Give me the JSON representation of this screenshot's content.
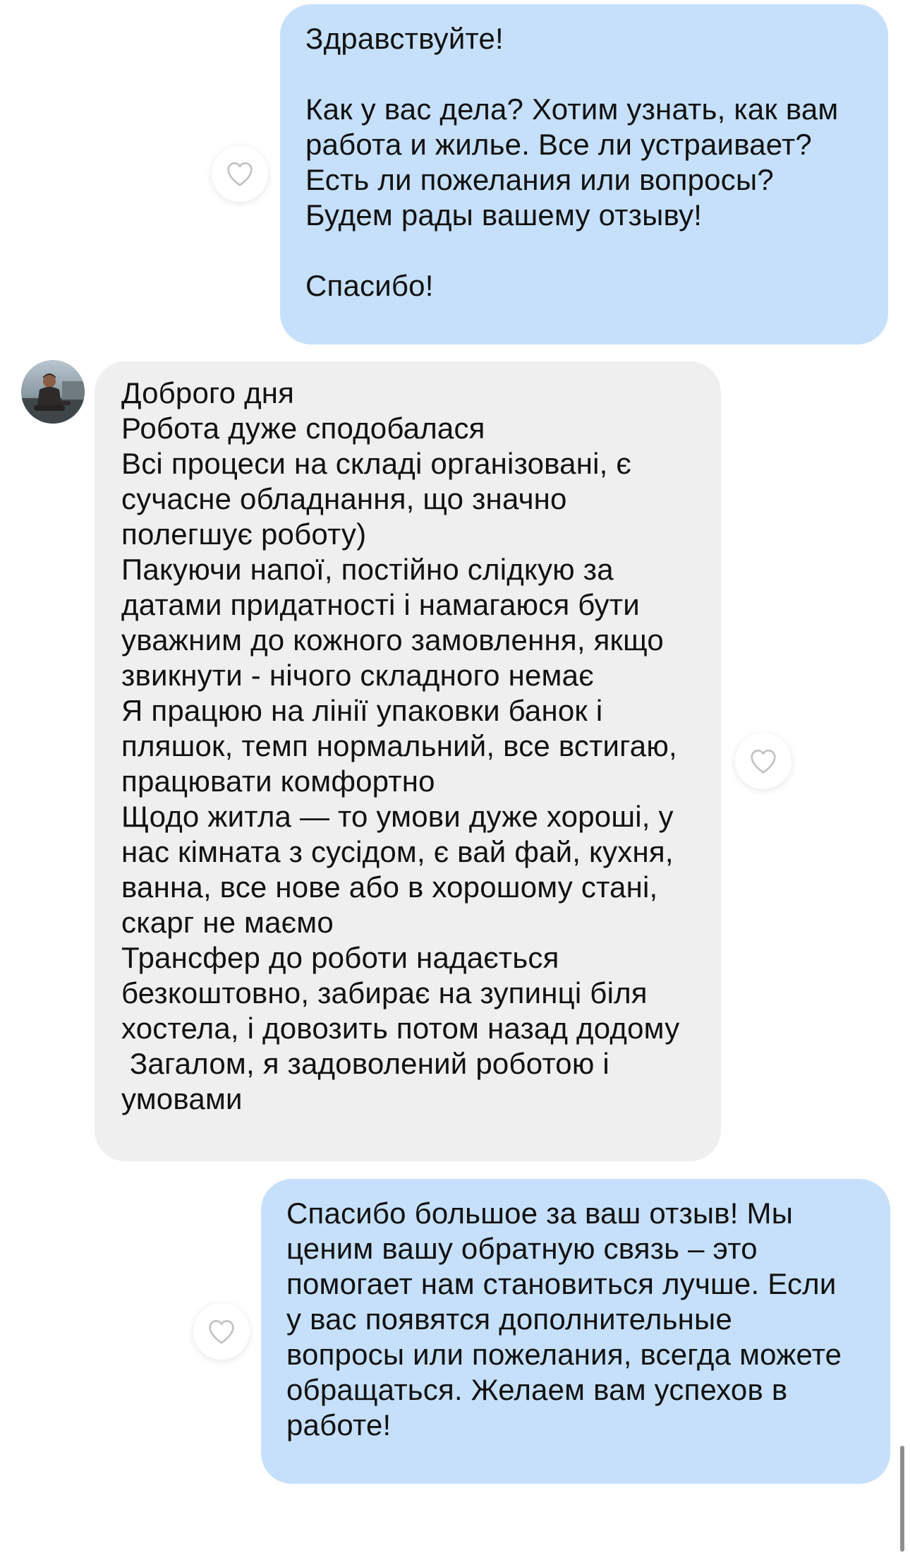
{
  "messages": [
    {
      "direction": "outgoing",
      "lines": [
        "Здравствуйте!",
        "",
        "Как у вас дела? Хотим узнать, как вам",
        "работа и жилье. Все ли устраивает?",
        "Есть ли пожелания или вопросы?",
        "Будем рады вашему отзыву!",
        "",
        "Спасибо!"
      ]
    },
    {
      "direction": "incoming",
      "lines": [
        "Доброго дня",
        "Робота дуже сподобалася",
        "Всі процеси на складі організовані, є",
        "сучасне обладнання, що значно",
        "полегшує роботу)",
        "Пакуючи напої, постійно слідкую за",
        "датами придатності і намагаюся бути",
        "уважним до кожного замовлення, якщо",
        "звикнути - нічого складного немає",
        "Я працюю на лінії упаковки банок і",
        "пляшок, темп нормальний, все встигаю,",
        "працювати комфортно",
        "Щодо житла — то умови дуже хороші, у",
        "нас кімната з сусідом, є вай фай, кухня,",
        "ванна, все нове або в хорошому стані,",
        "скарг не маємо",
        "Трансфер до роботи надається",
        "безкоштовно, забирає на зупинці біля",
        "хостела, і довозить потом назад додому",
        " Загалом, я задоволений роботою і",
        "умовами"
      ]
    },
    {
      "direction": "outgoing",
      "lines": [
        "Спасибо большое за ваш отзыв! Мы",
        "ценим вашу обратную связь – это",
        "помогает нам становиться лучше. Если",
        "у вас появятся дополнительные",
        "вопросы или пожелания, всегда можете",
        "обращаться. Желаем вам успехов в",
        "работе!"
      ]
    }
  ],
  "icons": {
    "like": "heart-outline-icon",
    "avatar": "user-avatar-photo"
  },
  "colors": {
    "outgoing_bubble": "#c6e0fb",
    "incoming_bubble": "#efefef",
    "text": "#111111",
    "heart_outline": "#c2c2c2"
  }
}
